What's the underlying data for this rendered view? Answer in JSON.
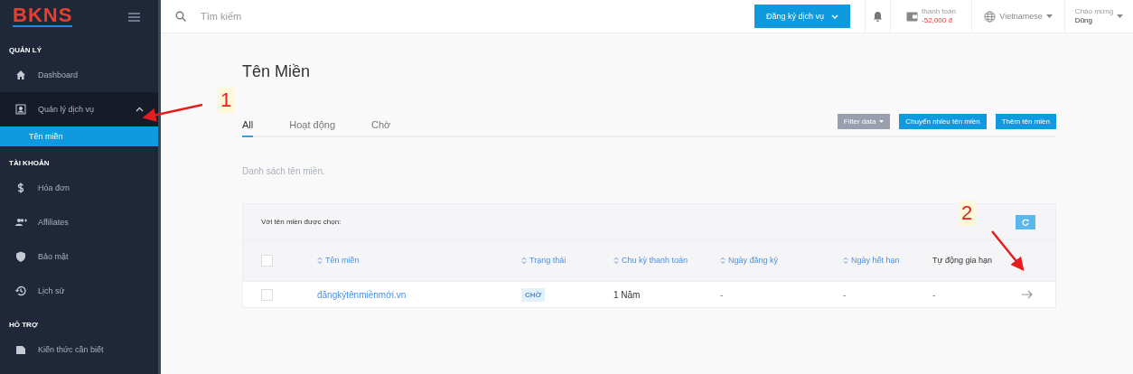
{
  "sidebar": {
    "logo": "BKNS",
    "sections": [
      {
        "heading": "QUẢN LÝ",
        "items": [
          {
            "label": "Dashboard",
            "selected": false,
            "expanded": false
          },
          {
            "label": "Quản lý dịch vụ",
            "selected": false,
            "expanded": true,
            "children": [
              {
                "label": "Tên miền",
                "selected": true
              }
            ]
          }
        ]
      },
      {
        "heading": "TÀI KHOẢN",
        "items": [
          {
            "label": "Hóa đơn",
            "selected": false,
            "expanded": false
          },
          {
            "label": "Affiliates",
            "selected": false,
            "expanded": false
          },
          {
            "label": "Bảo mật",
            "selected": false,
            "expanded": false
          },
          {
            "label": "Lịch sử",
            "selected": false,
            "expanded": false
          }
        ]
      },
      {
        "heading": "HỖ TRỢ",
        "items": [
          {
            "label": "Kiến thức cần biết",
            "selected": false,
            "expanded": false
          }
        ]
      }
    ]
  },
  "topbar": {
    "search": {
      "placeholder": "Tìm kiếm"
    },
    "register_button": "Đăng ký dịch vụ",
    "balance": {
      "label": "thanh toán",
      "amount": "-52,000 đ"
    },
    "language": "Vietnamese",
    "user": {
      "greeting": "Chào mừng",
      "name": "Dũng"
    }
  },
  "page": {
    "title": "Tên Miền",
    "tabs": [
      {
        "label": "All",
        "selected": true
      },
      {
        "label": "Hoạt động",
        "selected": false
      },
      {
        "label": "Chờ",
        "selected": false
      }
    ],
    "actions": [
      {
        "label": "Filter data",
        "kind": "dropdown"
      },
      {
        "label": "Chuyển nhiều tên miền",
        "kind": "primary"
      },
      {
        "label": "Thêm tên miền",
        "kind": "primary"
      }
    ],
    "subtitle": "Danh sách tên miền.",
    "table": {
      "bulk_label": "Với tên miền được chọn:",
      "select_all_checked": false,
      "columns": [
        {
          "label": "Tên miền",
          "sortable": true
        },
        {
          "label": "Trạng thái",
          "sortable": true
        },
        {
          "label": "Chu kỳ thanh toán",
          "sortable": true
        },
        {
          "label": "Ngày đăng ký",
          "sortable": true
        },
        {
          "label": "Ngày hết hạn",
          "sortable": true
        },
        {
          "label": "Tự động gia hạn",
          "sortable": false
        }
      ],
      "rows": [
        {
          "checked": false,
          "domain": "đăngkýtênmiềnmới.vn",
          "status": "CHỜ",
          "cycle": "1 Năm",
          "registered": "-",
          "expires": "-",
          "auto_renew": "-"
        }
      ]
    }
  },
  "annotations": [
    "1",
    "2"
  ]
}
